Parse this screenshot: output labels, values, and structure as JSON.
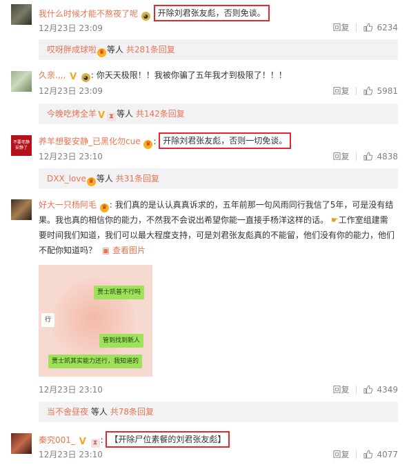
{
  "comments": [
    {
      "username": "我什么时候才能不熬夜了呢",
      "text": "开除刘君张友彪，否则免谈。",
      "date": "12月23日 23:09",
      "reply": "回复",
      "likes": "6234",
      "reply_bar": {
        "name": "哎呀胖成球啦",
        "deng": "等人",
        "count": "共281条回复"
      }
    },
    {
      "username": "久亲.,,,",
      "text": "你天天极限！！我被你骗了五年我才到极限了！！！",
      "date": "12月23日 23:09",
      "reply": "回复",
      "likes": "5981",
      "reply_bar": {
        "name": "今晚吃烤全羊",
        "deng": "等人",
        "count": "共142条回复"
      }
    },
    {
      "username": "养羊想娶安静_已黑化勿cue",
      "text": "开除刘君张友彪，否则一切免谈。",
      "date": "12月23日 23:10",
      "reply": "回复",
      "likes": "4838",
      "avatar_text": "不要老静 安静了",
      "reply_bar": {
        "name": "DXX_love",
        "deng": "等人",
        "count": "共31条回复"
      }
    },
    {
      "username": "好大一只杨阿毛",
      "text_line1": "我们真的是认认真真诉求的，五年前那一句风雨同行我信了5年，可是没有结",
      "text_line2": "果。我也真的相信你的能力，不然我不会说出希望你能一直接手杨洋这样的话。",
      "text_line2_tail": "工作室组建需",
      "text_line3": "要时间我们知道，我们可以最大程度支持，可是刘君张友彪真的不能留，他们没有你的能力，他们",
      "text_line4": "不配你知道吗？",
      "view_image": "查看图片",
      "chat_bubbles": [
        "贾士凯普不行吗",
        "行",
        "管到找到新人",
        "贾士凯其实能力还行，我知道的"
      ],
      "date": "12月23日 23:10",
      "reply": "回复",
      "likes": "4349",
      "reply_bar": {
        "name": "当不舍昼夜",
        "deng": "等人",
        "count": "共78条回复"
      }
    },
    {
      "username": "秦究001_",
      "text": "【开除尸位素餐的刘君张友彪】",
      "date": "12月23日 23:10",
      "reply": "回复",
      "likes": "4077"
    }
  ],
  "icons": {
    "like": "thumbs-up-icon",
    "verified": "verified-v-icon",
    "crown": "crown-badge-icon",
    "emoji": "face-emoji-icon",
    "hourglass": "hourglass-icon",
    "picture": "picture-icon",
    "pointing": "pointing-hand-emoji"
  },
  "colors": {
    "username": "#eb7350",
    "highlight_border": "#e5262b",
    "reply_bar_bg": "#f2f2f5",
    "meta_gray": "#808080"
  }
}
